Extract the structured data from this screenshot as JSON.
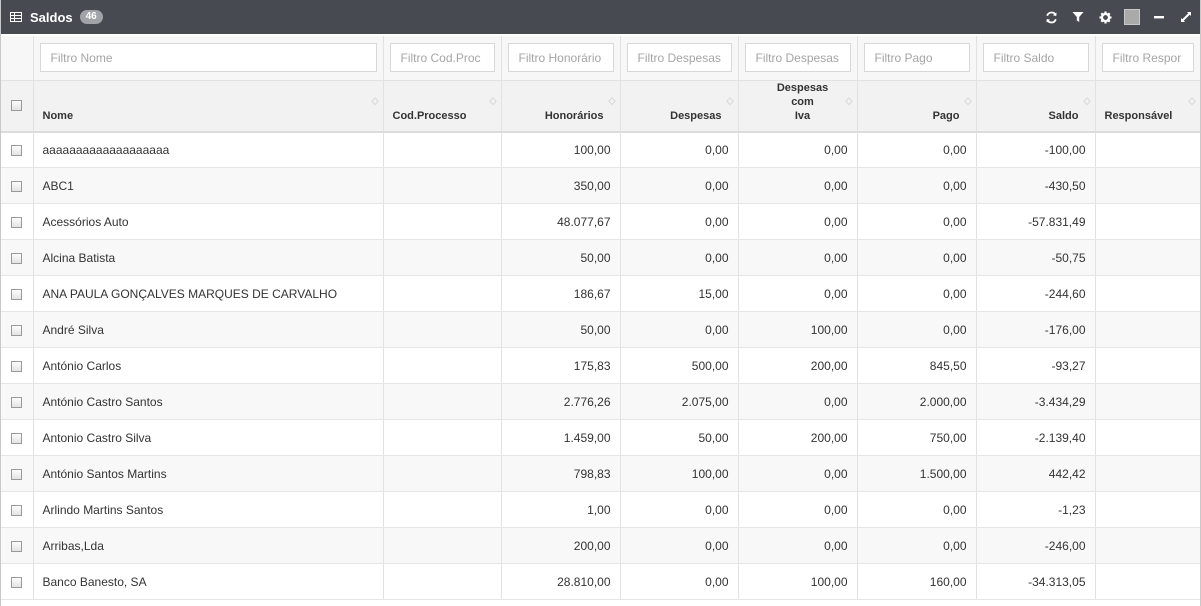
{
  "panel": {
    "title": "Saldos",
    "count": "46"
  },
  "filters": {
    "nome": "Filtro Nome",
    "cod_processo": "Filtro Cod.Proc",
    "honorarios": "Filtro Honorário",
    "despesas": "Filtro Despesas",
    "despesas_iva": "Filtro Despesas",
    "pago": "Filtro Pago",
    "saldo": "Filtro Saldo",
    "responsavel": "Filtro Respor"
  },
  "columns": {
    "nome": "Nome",
    "cod_processo": "Cod.Processo",
    "honorarios": "Honorários",
    "despesas": "Despesas",
    "despesas_iva_line1": "Despesas com",
    "despesas_iva_line2": "Iva",
    "pago": "Pago",
    "saldo": "Saldo",
    "responsavel": "Responsável"
  },
  "rows": [
    {
      "nome": "aaaaaaaaaaaaaaaaaaa",
      "cod": "",
      "honorarios": "100,00",
      "despesas": "0,00",
      "despesas_iva": "0,00",
      "pago": "0,00",
      "saldo": "-100,00",
      "responsavel": ""
    },
    {
      "nome": "ABC1",
      "cod": "",
      "honorarios": "350,00",
      "despesas": "0,00",
      "despesas_iva": "0,00",
      "pago": "0,00",
      "saldo": "-430,50",
      "responsavel": ""
    },
    {
      "nome": "Acessórios Auto",
      "cod": "",
      "honorarios": "48.077,67",
      "despesas": "0,00",
      "despesas_iva": "0,00",
      "pago": "0,00",
      "saldo": "-57.831,49",
      "responsavel": ""
    },
    {
      "nome": "Alcina Batista",
      "cod": "",
      "honorarios": "50,00",
      "despesas": "0,00",
      "despesas_iva": "0,00",
      "pago": "0,00",
      "saldo": "-50,75",
      "responsavel": ""
    },
    {
      "nome": "ANA PAULA GONÇALVES MARQUES DE CARVALHO",
      "cod": "",
      "honorarios": "186,67",
      "despesas": "15,00",
      "despesas_iva": "0,00",
      "pago": "0,00",
      "saldo": "-244,60",
      "responsavel": ""
    },
    {
      "nome": "André Silva",
      "cod": "",
      "honorarios": "50,00",
      "despesas": "0,00",
      "despesas_iva": "100,00",
      "pago": "0,00",
      "saldo": "-176,00",
      "responsavel": ""
    },
    {
      "nome": "António Carlos",
      "cod": "",
      "honorarios": "175,83",
      "despesas": "500,00",
      "despesas_iva": "200,00",
      "pago": "845,50",
      "saldo": "-93,27",
      "responsavel": ""
    },
    {
      "nome": "António Castro Santos",
      "cod": "",
      "honorarios": "2.776,26",
      "despesas": "2.075,00",
      "despesas_iva": "0,00",
      "pago": "2.000,00",
      "saldo": "-3.434,29",
      "responsavel": ""
    },
    {
      "nome": "Antonio Castro Silva",
      "cod": "",
      "honorarios": "1.459,00",
      "despesas": "50,00",
      "despesas_iva": "200,00",
      "pago": "750,00",
      "saldo": "-2.139,40",
      "responsavel": ""
    },
    {
      "nome": "António Santos Martins",
      "cod": "",
      "honorarios": "798,83",
      "despesas": "100,00",
      "despesas_iva": "0,00",
      "pago": "1.500,00",
      "saldo": "442,42",
      "responsavel": ""
    },
    {
      "nome": "Arlindo Martins Santos",
      "cod": "",
      "honorarios": "1,00",
      "despesas": "0,00",
      "despesas_iva": "0,00",
      "pago": "0,00",
      "saldo": "-1,23",
      "responsavel": ""
    },
    {
      "nome": "Arribas,Lda",
      "cod": "",
      "honorarios": "200,00",
      "despesas": "0,00",
      "despesas_iva": "0,00",
      "pago": "0,00",
      "saldo": "-246,00",
      "responsavel": ""
    },
    {
      "nome": "Banco Banesto, SA",
      "cod": "",
      "honorarios": "28.810,00",
      "despesas": "0,00",
      "despesas_iva": "100,00",
      "pago": "160,00",
      "saldo": "-34.313,05",
      "responsavel": ""
    }
  ],
  "icons": {
    "table": "table-icon",
    "refresh": "refresh-icon",
    "filter": "filter-icon",
    "settings": "gear-icon",
    "color": "color-square-icon",
    "collapse": "minimize-icon",
    "fullscreen": "expand-icon"
  },
  "colors": {
    "header_bg": "#474b51",
    "badge_bg": "#a0a3a7"
  }
}
